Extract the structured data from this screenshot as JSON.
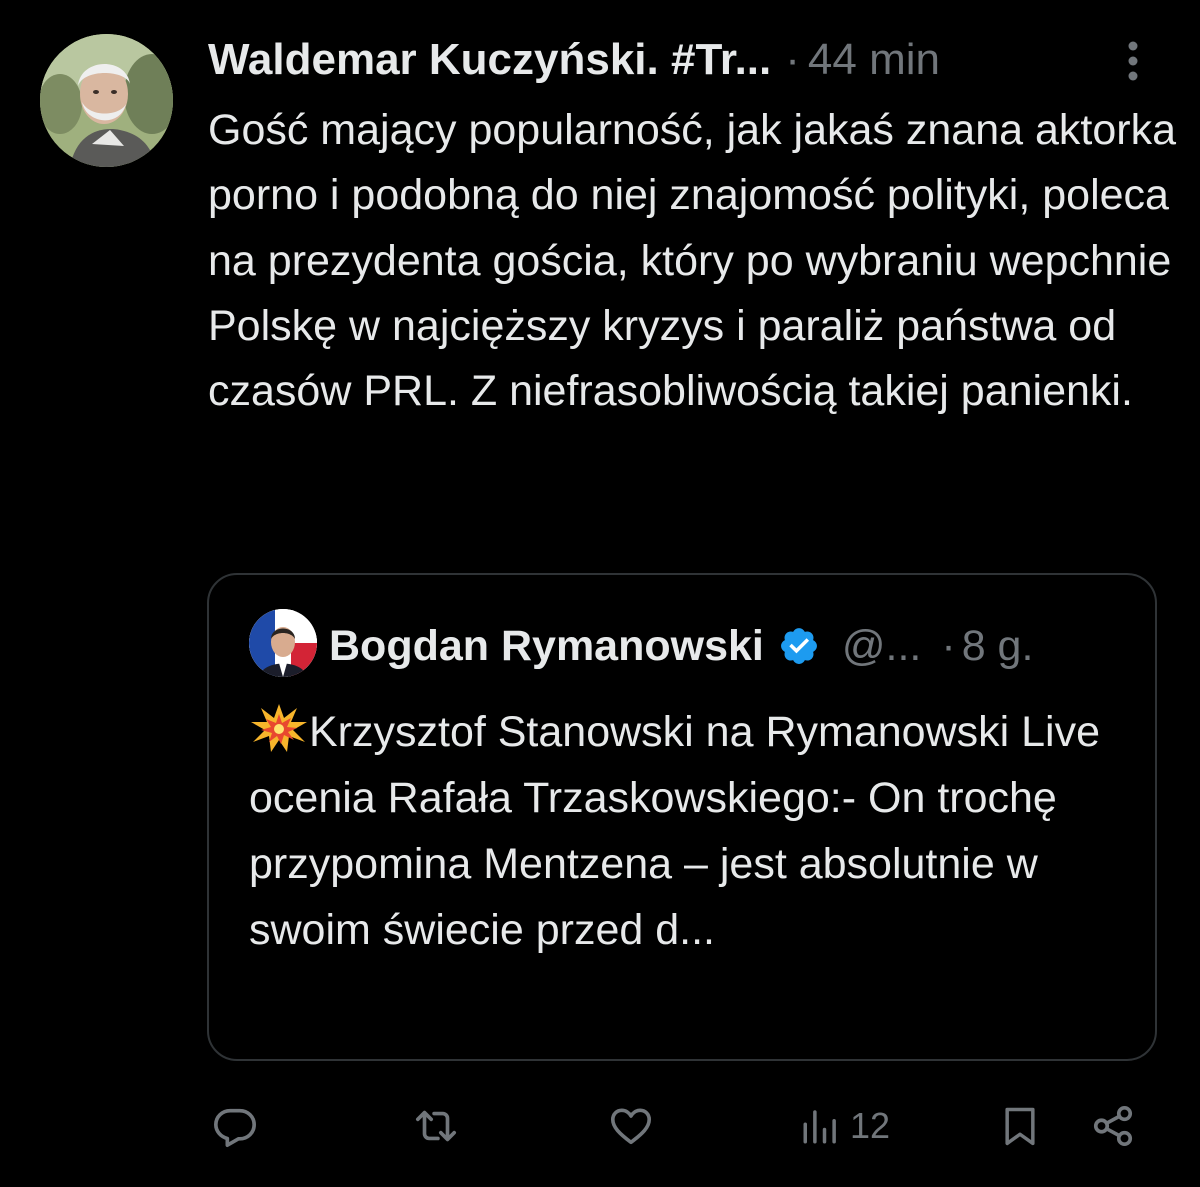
{
  "tweet": {
    "author_name": "Waldemar Kuczyński. #Tr...",
    "separator": "·",
    "time": "44 min",
    "text": "Gość mający popularność, jak jakaś znana aktorka porno i podobną do niej znajomość polityki, poleca na prezydenta gościa, który po wybraniu wepchnie Polskę w najcięższy kryzys i paraliż państwa od czasów PRL. Z niefrasobliwością takiej panienki."
  },
  "quoted": {
    "author_name": "Bogdan Rymanowski",
    "handle": "@...",
    "separator": "·",
    "time": "8 g.",
    "text": "Krzysztof Stanowski na Rymanowski Live ocenia Rafała Trzaskowskiego:- On trochę przypomina Mentzena – jest absolutnie w swoim świecie przed d..."
  },
  "actions": {
    "views_count": "12"
  },
  "icons": {
    "more": "more-vertical-icon",
    "verified": "verified-badge-icon",
    "burst": "collision-emoji-icon",
    "reply": "reply-icon",
    "retweet": "retweet-icon",
    "like": "like-icon",
    "views": "views-icon",
    "bookmark": "bookmark-icon",
    "share": "share-icon"
  },
  "colors": {
    "background": "#000000",
    "text_primary": "#e7e9ea",
    "text_secondary": "#71767b",
    "border": "#2f3336",
    "verified_blue": "#1d9bf0"
  }
}
